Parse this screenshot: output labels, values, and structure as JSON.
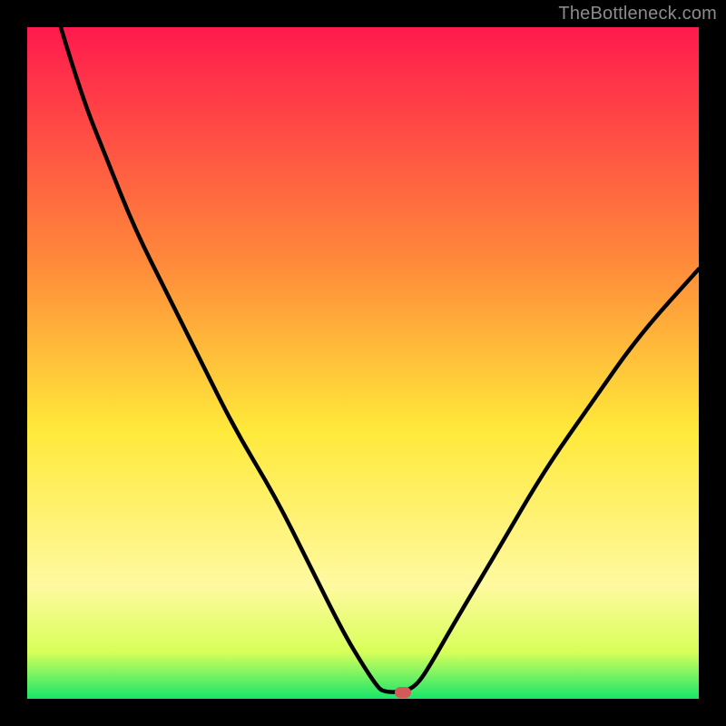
{
  "watermark": "TheBottleneck.com",
  "chart_data": {
    "type": "line",
    "title": "",
    "xlabel": "",
    "ylabel": "",
    "xlim": [
      0,
      100
    ],
    "ylim": [
      0,
      100
    ],
    "background": {
      "gradient_stops": [
        {
          "offset": 0,
          "color": "#ff1a4d"
        },
        {
          "offset": 35,
          "color": "#ff8a3a"
        },
        {
          "offset": 60,
          "color": "#ffe93a"
        },
        {
          "offset": 83,
          "color": "#fff9a0"
        },
        {
          "offset": 93,
          "color": "#d8ff5a"
        },
        {
          "offset": 100,
          "color": "#17e66a"
        }
      ]
    },
    "series": [
      {
        "name": "bottleneck-curve",
        "color": "#000000",
        "points": [
          {
            "x": 5,
            "y": 100
          },
          {
            "x": 8,
            "y": 90
          },
          {
            "x": 12,
            "y": 80
          },
          {
            "x": 16,
            "y": 70
          },
          {
            "x": 21,
            "y": 60
          },
          {
            "x": 26,
            "y": 50
          },
          {
            "x": 31,
            "y": 40
          },
          {
            "x": 37,
            "y": 30
          },
          {
            "x": 42,
            "y": 20
          },
          {
            "x": 47,
            "y": 10
          },
          {
            "x": 50,
            "y": 5
          },
          {
            "x": 52,
            "y": 2
          },
          {
            "x": 53,
            "y": 1
          },
          {
            "x": 56,
            "y": 1
          },
          {
            "x": 58,
            "y": 2
          },
          {
            "x": 60,
            "y": 5
          },
          {
            "x": 64,
            "y": 12
          },
          {
            "x": 70,
            "y": 22
          },
          {
            "x": 77,
            "y": 34
          },
          {
            "x": 84,
            "y": 44
          },
          {
            "x": 91,
            "y": 54
          },
          {
            "x": 100,
            "y": 64
          }
        ]
      }
    ],
    "marker": {
      "name": "selected-point",
      "x": 56,
      "y": 1,
      "color": "#d45a5a"
    }
  }
}
